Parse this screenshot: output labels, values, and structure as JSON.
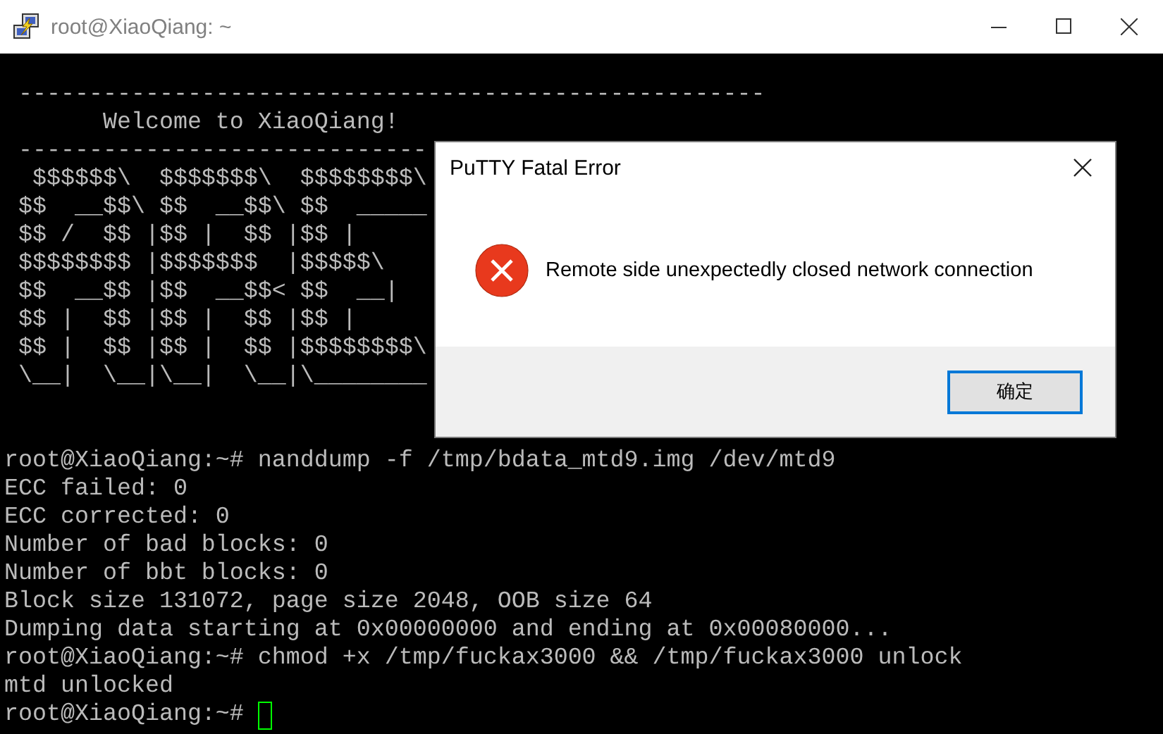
{
  "window": {
    "title": "root@XiaoQiang: ~"
  },
  "terminal": {
    "banner": [
      " -----------------------------------------------------",
      "       Welcome to XiaoQiang!",
      " -----------------------------",
      "  $$$$$$\\  $$$$$$$\\  $$$$$$$$\\",
      " $$  __$$\\ $$  __$$\\ $$  _____",
      " $$ /  $$ |$$ |  $$ |$$ |",
      " $$$$$$$$ |$$$$$$$  |$$$$$\\",
      " $$  __$$ |$$  __$$< $$  __|",
      " $$ |  $$ |$$ |  $$ |$$ |",
      " $$ |  $$ |$$ |  $$ |$$$$$$$$\\",
      " \\__|  \\__|\\__|  \\__|\\________"
    ],
    "output": [
      "root@XiaoQiang:~# nanddump -f /tmp/bdata_mtd9.img /dev/mtd9",
      "ECC failed: 0",
      "ECC corrected: 0",
      "Number of bad blocks: 0",
      "Number of bbt blocks: 0",
      "Block size 131072, page size 2048, OOB size 64",
      "Dumping data starting at 0x00000000 and ending at 0x00080000...",
      "root@XiaoQiang:~# chmod +x /tmp/fuckax3000 && /tmp/fuckax3000 unlock",
      "mtd unlocked",
      "root@XiaoQiang:~# "
    ],
    "cursor_visible": true
  },
  "dialog": {
    "title": "PuTTY Fatal Error",
    "message": "Remote side unexpectedly closed network connection",
    "buttons": [
      {
        "label": "确定",
        "default": true
      }
    ]
  }
}
